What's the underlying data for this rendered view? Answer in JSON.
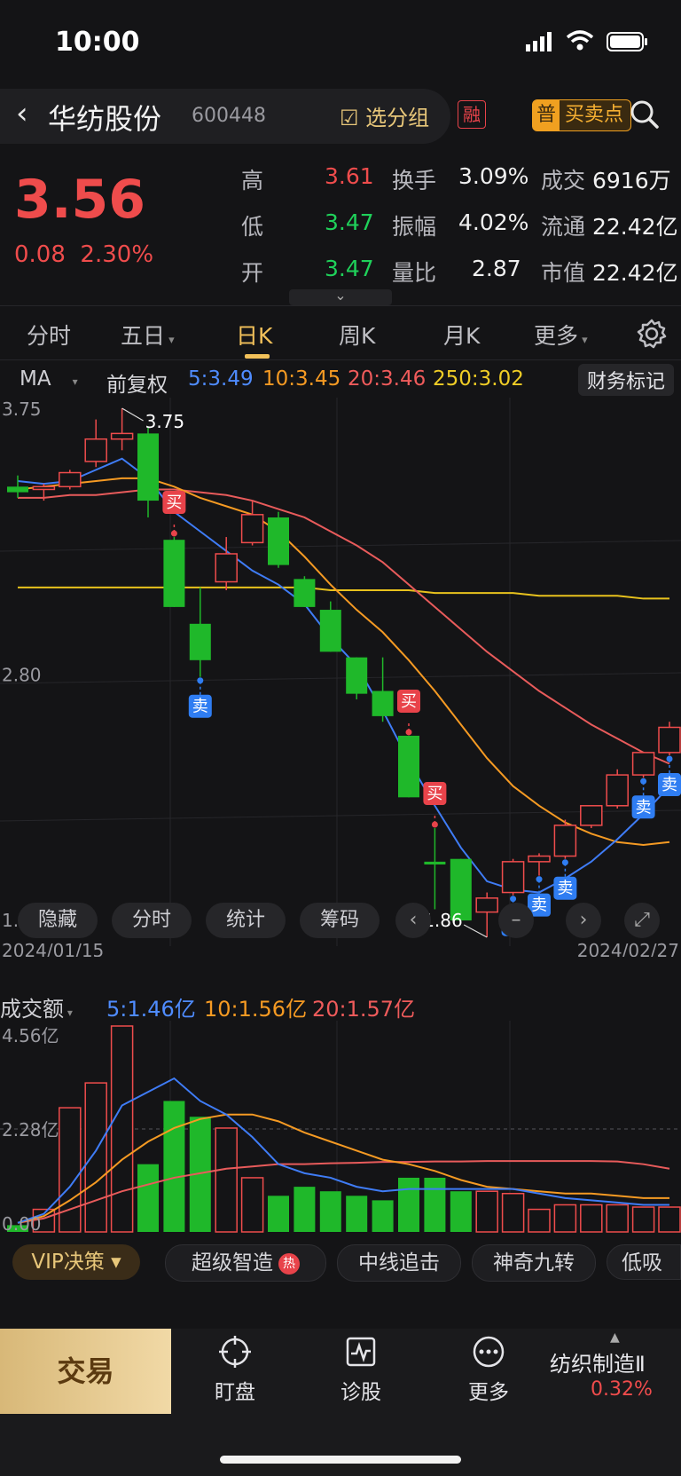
{
  "status_bar": {
    "time": "10:00"
  },
  "header": {
    "stock_name": "华纺股份",
    "stock_code": "600448",
    "select_group": "选分组",
    "margin_badge": "融",
    "buy_sell_badge": "普",
    "buy_sell_label": "买卖点"
  },
  "quote": {
    "price": "3.56",
    "change": "0.08",
    "change_pct": "2.30%",
    "stats": [
      {
        "label": "高",
        "value": "3.61",
        "label2": "换手",
        "value2": "3.09%",
        "label3": "成交",
        "value3": "6916万"
      },
      {
        "label": "低",
        "value": "3.47",
        "label2": "振幅",
        "value2": "4.02%",
        "label3": "流通",
        "value3": "22.42亿"
      },
      {
        "label": "开",
        "value": "3.47",
        "label2": "量比",
        "value2": "2.87",
        "label3": "市值",
        "value3": "22.42亿"
      }
    ]
  },
  "tabs": [
    "分时",
    "五日",
    "日K",
    "周K",
    "月K",
    "更多"
  ],
  "active_tab": "日K",
  "ma_bar": {
    "indicator": "MA",
    "adjust": "前复权",
    "ma5": "5:3.49",
    "ma10": "10:3.45",
    "ma20": "20:3.46",
    "ma250": "250:3.02",
    "finance_mark": "财务标记"
  },
  "colors": {
    "up": "#ef4c4c",
    "down": "#1fb82a",
    "ma5": "#3f7cf6",
    "ma10": "#f59a23",
    "ma20": "#e85b5b",
    "ma250": "#e8c21d",
    "accent": "#f2c15a"
  },
  "chart_labels": {
    "y_top": "3.75",
    "y_mid": "2.80",
    "y_bottom": "1.86",
    "high_mark": "3.75",
    "low_mark": "1.86",
    "date_start": "2024/01/15",
    "date_end": "2024/02/27",
    "buy": "买",
    "sell": "卖"
  },
  "chart_tools": [
    "隐藏",
    "分时",
    "统计",
    "筹码"
  ],
  "volume": {
    "indicator": "成交额",
    "ma5": "5:1.46亿",
    "ma10": "10:1.56亿",
    "ma20": "20:1.57亿",
    "y_top": "4.56亿",
    "y_mid": "2.28亿",
    "y_bottom": "0.00"
  },
  "chart_data": {
    "type": "candlestick",
    "y_range": [
      1.86,
      3.75
    ],
    "candles": [
      {
        "o": 3.47,
        "h": 3.51,
        "l": 3.43,
        "c": 3.45
      },
      {
        "o": 3.46,
        "h": 3.48,
        "l": 3.42,
        "c": 3.47
      },
      {
        "o": 3.47,
        "h": 3.53,
        "l": 3.46,
        "c": 3.52
      },
      {
        "o": 3.56,
        "h": 3.71,
        "l": 3.54,
        "c": 3.64
      },
      {
        "o": 3.64,
        "h": 3.75,
        "l": 3.6,
        "c": 3.66
      },
      {
        "o": 3.66,
        "h": 3.68,
        "l": 3.36,
        "c": 3.42
      },
      {
        "o": 3.28,
        "h": 3.29,
        "l": 3.04,
        "c": 3.04
      },
      {
        "o": 2.98,
        "h": 3.11,
        "l": 2.79,
        "c": 2.85
      },
      {
        "o": 3.13,
        "h": 3.29,
        "l": 3.1,
        "c": 3.23
      },
      {
        "o": 3.27,
        "h": 3.42,
        "l": 3.26,
        "c": 3.37
      },
      {
        "o": 3.36,
        "h": 3.38,
        "l": 3.18,
        "c": 3.19
      },
      {
        "o": 3.14,
        "h": 3.15,
        "l": 3.04,
        "c": 3.04
      },
      {
        "o": 3.03,
        "h": 3.06,
        "l": 2.88,
        "c": 2.88
      },
      {
        "o": 2.86,
        "h": 2.86,
        "l": 2.71,
        "c": 2.73
      },
      {
        "o": 2.74,
        "h": 2.86,
        "l": 2.63,
        "c": 2.65
      },
      {
        "o": 2.58,
        "h": 2.58,
        "l": 2.36,
        "c": 2.36
      },
      {
        "o": 2.13,
        "h": 2.25,
        "l": 1.96,
        "c": 2.12
      },
      {
        "o": 2.14,
        "h": 2.14,
        "l": 1.92,
        "c": 1.92
      },
      {
        "o": 1.95,
        "h": 2.02,
        "l": 1.86,
        "c": 2.0
      },
      {
        "o": 2.02,
        "h": 2.14,
        "l": 2.01,
        "c": 2.13
      },
      {
        "o": 2.13,
        "h": 2.16,
        "l": 2.08,
        "c": 2.15
      },
      {
        "o": 2.15,
        "h": 2.28,
        "l": 2.14,
        "c": 2.26
      },
      {
        "o": 2.26,
        "h": 2.33,
        "l": 2.25,
        "c": 2.33
      },
      {
        "o": 2.33,
        "h": 2.46,
        "l": 2.32,
        "c": 2.44
      },
      {
        "o": 2.44,
        "h": 2.52,
        "l": 2.43,
        "c": 2.52
      },
      {
        "o": 2.52,
        "h": 2.63,
        "l": 2.51,
        "c": 2.61
      }
    ],
    "ma5": [
      3.49,
      3.48,
      3.49,
      3.53,
      3.57,
      3.5,
      3.38,
      3.31,
      3.24,
      3.17,
      3.12,
      3.05,
      2.93,
      2.83,
      2.67,
      2.49,
      2.33,
      2.18,
      2.06,
      2.03,
      2.02,
      2.07,
      2.13,
      2.21,
      2.3,
      2.4
    ],
    "ma10": [
      3.46,
      3.47,
      3.48,
      3.49,
      3.5,
      3.5,
      3.47,
      3.43,
      3.4,
      3.37,
      3.31,
      3.22,
      3.12,
      3.03,
      2.95,
      2.85,
      2.74,
      2.62,
      2.5,
      2.4,
      2.33,
      2.27,
      2.23,
      2.2,
      2.19,
      2.2
    ],
    "ma20": [
      3.43,
      3.43,
      3.44,
      3.44,
      3.45,
      3.46,
      3.46,
      3.45,
      3.44,
      3.42,
      3.39,
      3.36,
      3.31,
      3.26,
      3.2,
      3.12,
      3.04,
      2.96,
      2.88,
      2.81,
      2.74,
      2.68,
      2.62,
      2.57,
      2.52,
      2.48
    ],
    "ma250": [
      3.11,
      3.11,
      3.11,
      3.11,
      3.11,
      3.11,
      3.11,
      3.11,
      3.11,
      3.11,
      3.11,
      3.11,
      3.1,
      3.1,
      3.1,
      3.1,
      3.09,
      3.09,
      3.09,
      3.09,
      3.08,
      3.08,
      3.08,
      3.08,
      3.07,
      3.07
    ],
    "signals": [
      {
        "i": 6,
        "type": "buy"
      },
      {
        "i": 7,
        "type": "sell"
      },
      {
        "i": 15,
        "type": "buy"
      },
      {
        "i": 16,
        "type": "buy"
      },
      {
        "i": 19,
        "type": "sell"
      },
      {
        "i": 20,
        "type": "sell"
      },
      {
        "i": 21,
        "type": "sell"
      },
      {
        "i": 24,
        "type": "sell"
      },
      {
        "i": 25,
        "type": "sell"
      }
    ],
    "volume_y_range": [
      0,
      4.56
    ],
    "volumes": [
      0.15,
      0.5,
      2.75,
      3.3,
      4.56,
      1.5,
      2.9,
      2.55,
      2.3,
      1.2,
      0.8,
      1.0,
      0.9,
      0.8,
      0.7,
      1.2,
      1.2,
      0.9,
      0.9,
      0.85,
      0.5,
      0.6,
      0.6,
      0.6,
      0.55,
      0.55
    ],
    "vol_ma5": [
      0.2,
      0.4,
      1.0,
      1.8,
      2.8,
      3.1,
      3.4,
      2.9,
      2.6,
      2.1,
      1.5,
      1.3,
      1.2,
      1.0,
      0.9,
      0.95,
      0.95,
      0.95,
      0.95,
      0.95,
      0.85,
      0.75,
      0.7,
      0.65,
      0.6,
      0.6
    ],
    "vol_ma10": [
      0.2,
      0.35,
      0.7,
      1.1,
      1.6,
      2.0,
      2.3,
      2.5,
      2.6,
      2.6,
      2.45,
      2.2,
      2.0,
      1.8,
      1.6,
      1.5,
      1.35,
      1.15,
      1.0,
      0.95,
      0.9,
      0.85,
      0.85,
      0.8,
      0.75,
      0.75
    ],
    "vol_ma20": [
      0.2,
      0.3,
      0.5,
      0.7,
      0.9,
      1.05,
      1.2,
      1.3,
      1.4,
      1.45,
      1.5,
      1.5,
      1.52,
      1.53,
      1.55,
      1.55,
      1.56,
      1.56,
      1.57,
      1.57,
      1.57,
      1.57,
      1.57,
      1.56,
      1.5,
      1.4
    ]
  },
  "strategies": {
    "vip": "VIP决策",
    "items": [
      "超级智造",
      "中线追击",
      "神奇九转",
      "低吸龍"
    ],
    "hot_badge": "热"
  },
  "bottom_bar": {
    "trade": "交易",
    "items": [
      "盯盘",
      "诊股",
      "更多"
    ],
    "industry": "纺织制造Ⅱ",
    "industry_pct": "0.32%"
  }
}
